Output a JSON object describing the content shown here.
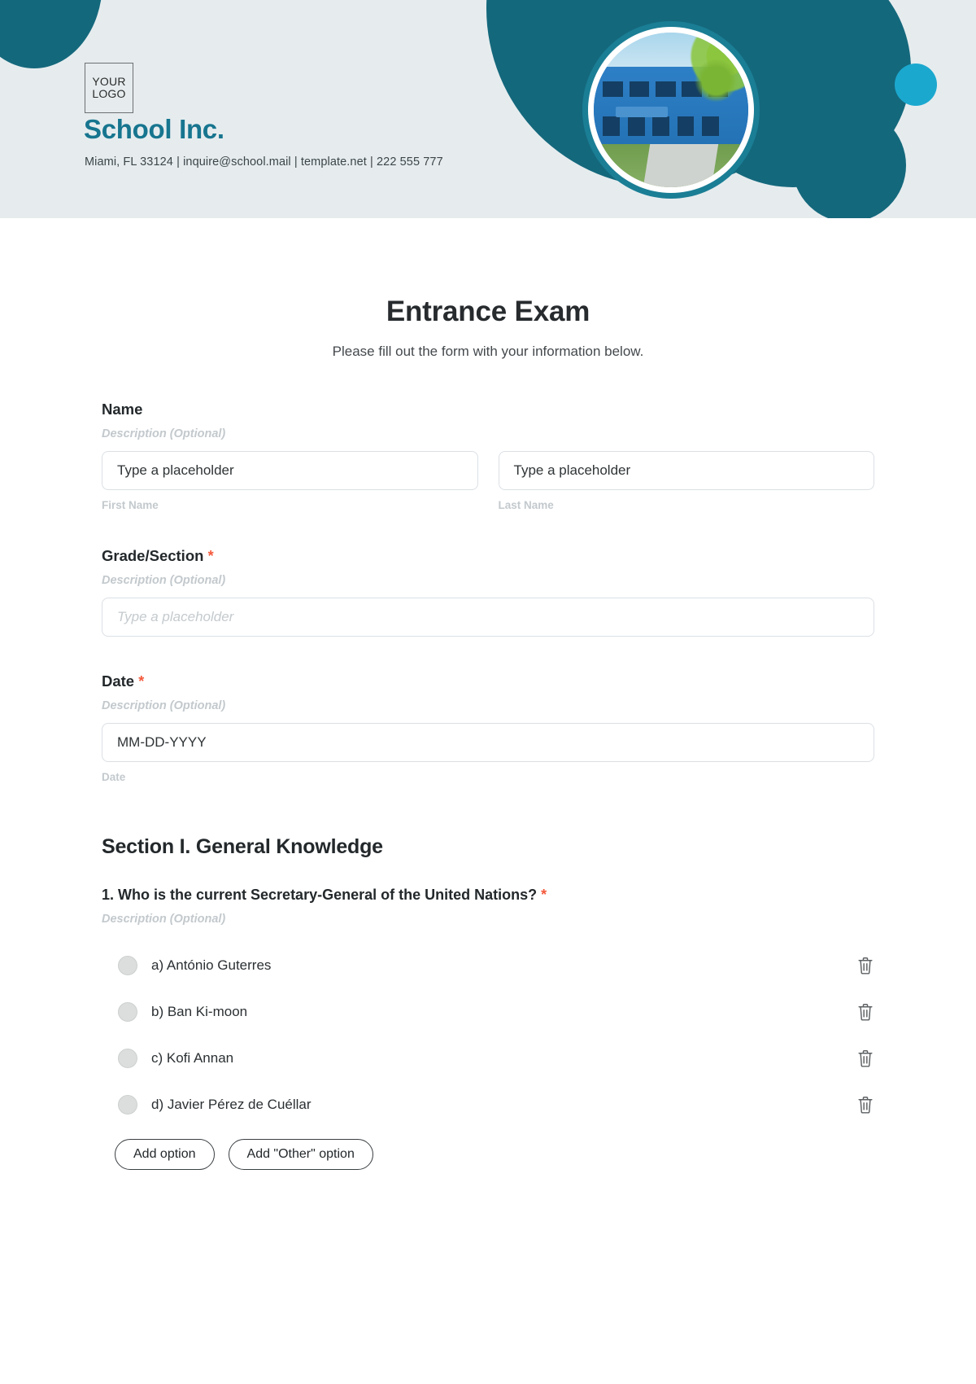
{
  "header": {
    "logo_line1": "YOUR",
    "logo_line2": "LOGO",
    "brand_name": "School Inc.",
    "contact": "Miami, FL 33124 | inquire@school.mail | template.net | 222 555 777",
    "colors": {
      "banner_bg": "#e6ecee",
      "teal": "#14687c",
      "brand_text": "#17758f",
      "cyan": "#1ba8cf"
    },
    "icons": {
      "portrait": "school-building-photo"
    }
  },
  "form": {
    "title": "Entrance Exam",
    "subtitle": "Please fill out the form with your information below.",
    "required_marker": "*",
    "description_placeholder": "Description (Optional)",
    "fields": [
      {
        "label": "Name",
        "required": false,
        "description": "Description (Optional)",
        "inputs": [
          {
            "value": "Type a placeholder",
            "sub_label": "First Name",
            "style": "solid"
          },
          {
            "value": "Type a placeholder",
            "sub_label": "Last Name",
            "style": "solid"
          }
        ]
      },
      {
        "label": "Grade/Section",
        "required": true,
        "description": "Description (Optional)",
        "inputs": [
          {
            "value": "Type a placeholder",
            "sub_label": "",
            "style": "italic"
          }
        ]
      },
      {
        "label": "Date",
        "required": true,
        "description": "Description (Optional)",
        "inputs": [
          {
            "value": "MM-DD-YYYY",
            "sub_label": "Date",
            "style": "solid"
          }
        ]
      }
    ],
    "section": {
      "heading": "Section I. General Knowledge",
      "question": {
        "number": "1.",
        "text": "1. Who is the current Secretary-General of the United Nations?",
        "required": true,
        "description": "Description (Optional)",
        "options": [
          {
            "label": "a) António Guterres",
            "delete_icon": "trash-icon"
          },
          {
            "label": "b) Ban Ki-moon",
            "delete_icon": "trash-icon"
          },
          {
            "label": "c) Kofi Annan",
            "delete_icon": "trash-icon"
          },
          {
            "label": "d) Javier Pérez de Cuéllar",
            "delete_icon": "trash-icon"
          }
        ],
        "buttons": [
          {
            "label": "Add option"
          },
          {
            "label": "Add \"Other\" option"
          }
        ]
      }
    }
  }
}
